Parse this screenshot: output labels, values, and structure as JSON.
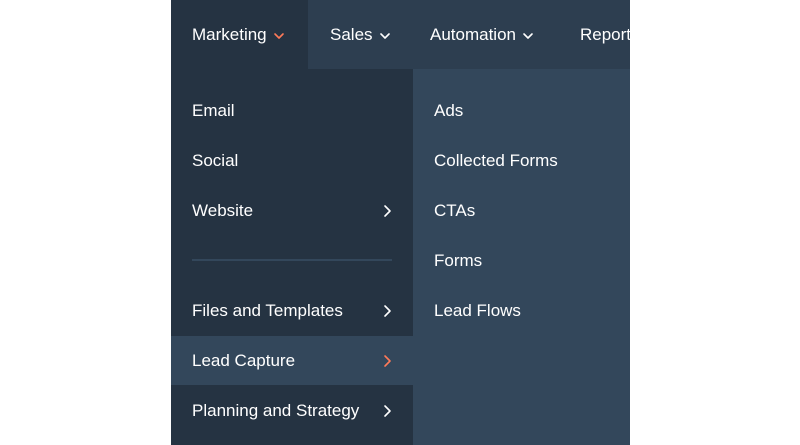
{
  "topnav": {
    "items": [
      {
        "label": "Marketing",
        "active": true
      },
      {
        "label": "Sales"
      },
      {
        "label": "Automation"
      },
      {
        "label": "Report"
      }
    ]
  },
  "menu": {
    "items": [
      {
        "label": "Email"
      },
      {
        "label": "Social"
      },
      {
        "label": "Website",
        "has_submenu": true
      },
      {
        "label": "Files and Templates",
        "has_submenu": true
      },
      {
        "label": "Lead Capture",
        "has_submenu": true,
        "active": true
      },
      {
        "label": "Planning and Strategy",
        "has_submenu": true
      }
    ]
  },
  "submenu": {
    "items": [
      {
        "label": "Ads"
      },
      {
        "label": "Collected Forms"
      },
      {
        "label": "CTAs"
      },
      {
        "label": "Forms"
      },
      {
        "label": "Lead Flows"
      }
    ]
  },
  "colors": {
    "accent": "#ff7a59",
    "nav_bg": "#2d3e50",
    "menu_bg": "#253342",
    "submenu_bg": "#33475b"
  }
}
